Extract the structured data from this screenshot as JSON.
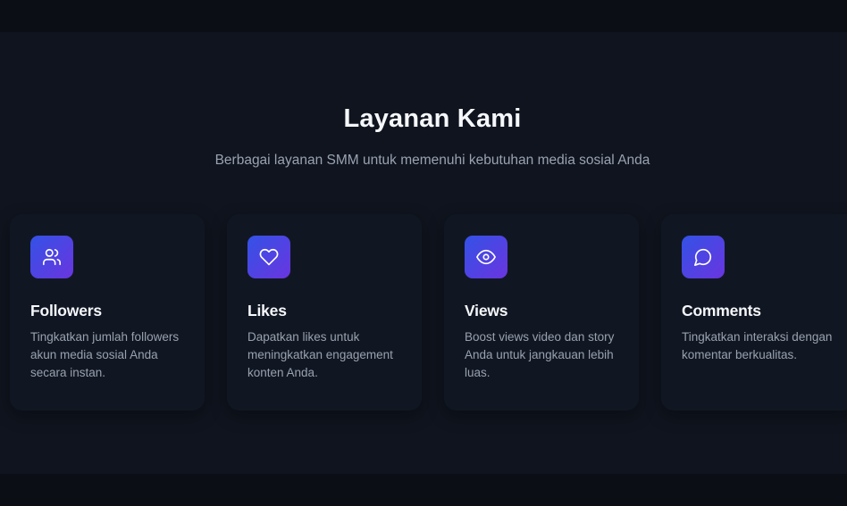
{
  "services": {
    "title": "Layanan Kami",
    "subtitle": "Berbagai layanan SMM untuk memenuhi kebutuhan media sosial Anda",
    "items": [
      {
        "icon": "users-icon",
        "title": "Followers",
        "description": "Tingkatkan jumlah followers akun media sosial Anda secara instan."
      },
      {
        "icon": "heart-icon",
        "title": "Likes",
        "description": "Dapatkan likes untuk meningkatkan engagement konten Anda."
      },
      {
        "icon": "eye-icon",
        "title": "Views",
        "description": "Boost views video dan story Anda untuk jangkauan lebih luas."
      },
      {
        "icon": "message-circle-icon",
        "title": "Comments",
        "description": "Tingkatkan interaksi dengan komentar berkualitas."
      }
    ]
  },
  "colors": {
    "page_background": "#0b0e15",
    "section_background": "#0f141e",
    "card_background": "#111722",
    "accent_gradient_start": "#3352e6",
    "accent_gradient_end": "#6a35e0",
    "heading_text": "#f5f7fb",
    "muted_text": "#98a1b0"
  }
}
